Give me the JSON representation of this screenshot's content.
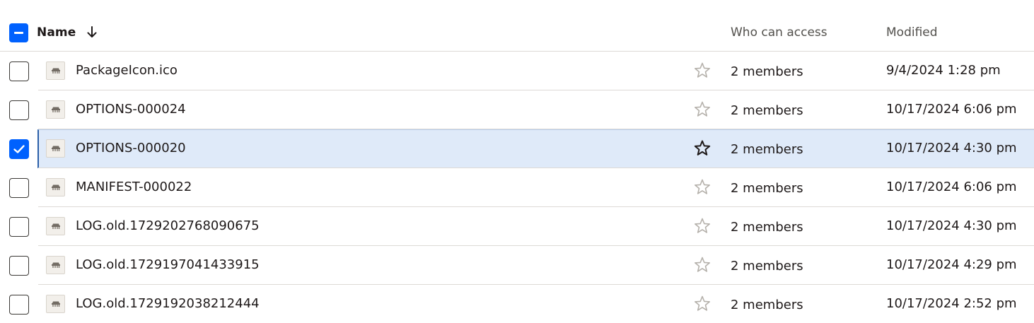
{
  "header": {
    "name_label": "Name",
    "access_label": "Who can access",
    "modified_label": "Modified",
    "sort_icon": "arrow-down-icon",
    "select_all_state": "indeterminate"
  },
  "colors": {
    "accent": "#0061fe",
    "selected_row": "#dfeaf9",
    "divider": "#dddad6"
  },
  "rows": [
    {
      "name": "PackageIcon.ico",
      "access": "2 members",
      "modified": "9/4/2024 1:28 pm",
      "checked": false,
      "starred": false
    },
    {
      "name": "OPTIONS-000024",
      "access": "2 members",
      "modified": "10/17/2024 6:06 pm",
      "checked": false,
      "starred": false
    },
    {
      "name": "OPTIONS-000020",
      "access": "2 members",
      "modified": "10/17/2024 4:30 pm",
      "checked": true,
      "starred": false
    },
    {
      "name": "MANIFEST-000022",
      "access": "2 members",
      "modified": "10/17/2024 6:06 pm",
      "checked": false,
      "starred": false
    },
    {
      "name": "LOG.old.1729202768090675",
      "access": "2 members",
      "modified": "10/17/2024 4:30 pm",
      "checked": false,
      "starred": false
    },
    {
      "name": "LOG.old.1729197041433915",
      "access": "2 members",
      "modified": "10/17/2024 4:29 pm",
      "checked": false,
      "starred": false
    },
    {
      "name": "LOG.old.1729192038212444",
      "access": "2 members",
      "modified": "10/17/2024 2:52 pm",
      "checked": false,
      "starred": false
    }
  ]
}
